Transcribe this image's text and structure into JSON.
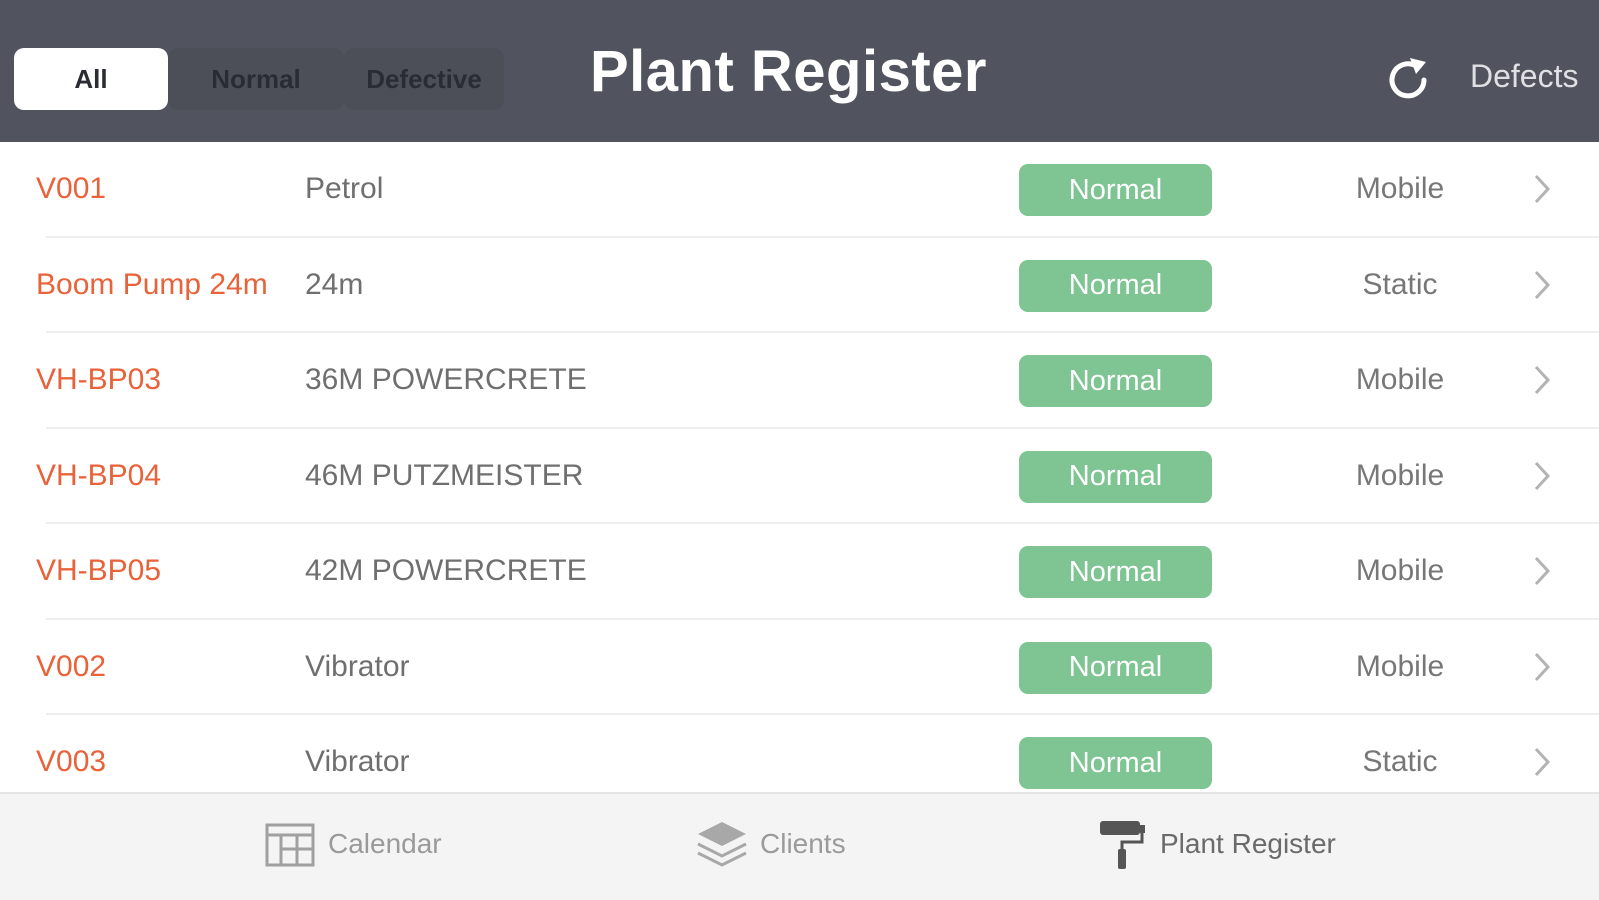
{
  "header": {
    "title": "Plant Register",
    "filters": [
      "All",
      "Normal",
      "Defective"
    ],
    "selected_filter": "All",
    "refresh_icon": "refresh-icon",
    "defects_label": "Defects"
  },
  "rows": [
    {
      "code": "V001",
      "description": "Petrol",
      "status": "Normal",
      "type": "Mobile"
    },
    {
      "code": "Boom Pump 24m",
      "description": "24m",
      "status": "Normal",
      "type": "Static"
    },
    {
      "code": "VH-BP03",
      "description": "36M POWERCRETE",
      "status": "Normal",
      "type": "Mobile"
    },
    {
      "code": "VH-BP04",
      "description": "46M PUTZMEISTER",
      "status": "Normal",
      "type": "Mobile"
    },
    {
      "code": "VH-BP05",
      "description": "42M POWERCRETE",
      "status": "Normal",
      "type": "Mobile"
    },
    {
      "code": "V002",
      "description": "Vibrator",
      "status": "Normal",
      "type": "Mobile"
    },
    {
      "code": "V003",
      "description": "Vibrator",
      "status": "Normal",
      "type": "Static"
    }
  ],
  "tabbar": {
    "tabs": [
      {
        "label": "Calendar",
        "icon": "calendar-icon"
      },
      {
        "label": "Clients",
        "icon": "layers-icon"
      },
      {
        "label": "Plant Register",
        "icon": "paint-roller-icon"
      }
    ],
    "selected": "Plant Register"
  },
  "colors": {
    "header_bg": "#51545e",
    "code_text": "#e8623a",
    "status_normal": "#7fc493"
  }
}
